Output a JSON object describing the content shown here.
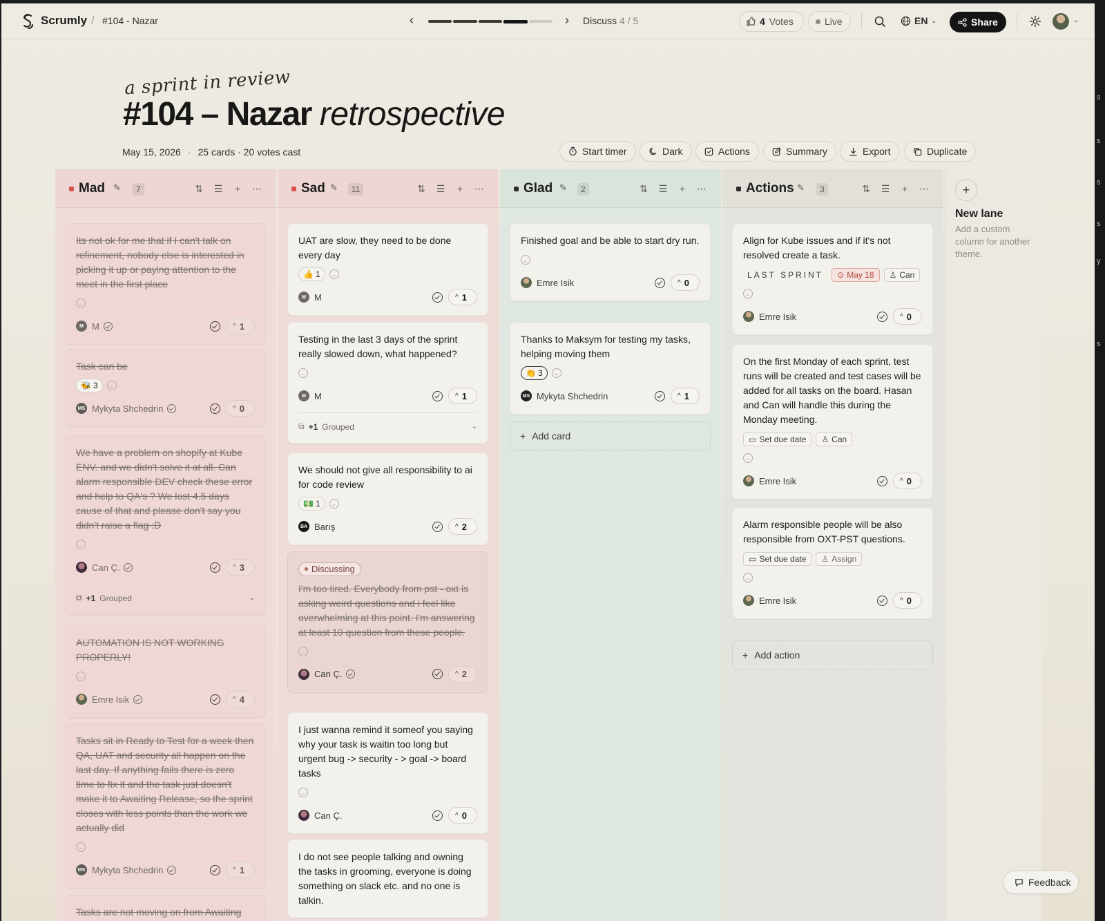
{
  "app": {
    "brand": "Scrumly",
    "breadcrumb": "#104 - Nazar"
  },
  "nav": {
    "phase_label": "Discuss",
    "phase_step": "4 / 5",
    "progress_current": 4,
    "progress_total": 5
  },
  "header": {
    "votes_count": "4",
    "votes_label": "Votes",
    "live_label": "Live",
    "lang": "EN",
    "share_label": "Share"
  },
  "hero": {
    "handwritten": "a sprint in review",
    "title_bold": "#104 – Nazar",
    "title_italic": "retrospective",
    "date": "May 15, 2026",
    "stats": "25 cards · 20 votes cast"
  },
  "toolbar": {
    "start_timer": "Start timer",
    "dark": "Dark",
    "actions": "Actions",
    "summary": "Summary",
    "export": "Export",
    "duplicate": "Duplicate"
  },
  "lanes": [
    {
      "name": "Mad",
      "count": "7",
      "color": "#d9534f",
      "cards": [
        {
          "text": "Its not ok for me that if I can't talk on refinement, nobody else is interested in picking it up or paying attention to the meet in the first place",
          "author": "M",
          "initials": "M",
          "votes": "1"
        },
        {
          "text": "Task can be",
          "reaction": "🐝",
          "reaction_count": "3",
          "author": "Mykyta Shchedrin",
          "initials": "MS",
          "votes": "0"
        },
        {
          "text": "We have a problem on shopify at Kube ENV. and we didn't solve it at all. Can alarm responsible DEV check these error and help to QA's ? We lost 4.5 days cause of that and please don't say you didn't raise a flag :D",
          "author": "Can Ç.",
          "votes": "3",
          "grouped": "+1",
          "grouped_label": "Grouped"
        },
        {
          "text": "AUTOMATION IS NOT WORKING PROPERLY!",
          "author": "Emre Isik",
          "votes": "4"
        },
        {
          "text": "Tasks sit in Ready to Test for a week then QA, UAT and security all happen on the last day. If anything fails there is zero time to fix it and the task just doesn't make it to Awaiting Release, so the sprint closes with less points than the work we actually did",
          "author": "Mykyta Shchedrin",
          "initials": "MS",
          "votes": "1"
        },
        {
          "text": "Tasks are not moving on from Awaiting"
        }
      ]
    },
    {
      "name": "Sad",
      "count": "11",
      "color": "#d9534f",
      "cards": [
        {
          "text": "UAT are slow, they need to be done every day",
          "reaction": "👍",
          "reaction_count": "1",
          "author": "M",
          "initials": "M",
          "votes": "1"
        },
        {
          "text": "Testing in the last 3 days of the sprint really slowed down, what happened?",
          "author": "M",
          "initials": "M",
          "votes": "1",
          "grouped": "+1",
          "grouped_label": "Grouped"
        },
        {
          "text": "We should not give all responsibility to ai for code review",
          "reaction": "💵",
          "reaction_count": "1",
          "author": "Barış",
          "initials": "BA",
          "votes": "2"
        },
        {
          "badge": "Discussing",
          "text": "I'm too tired. Everybody from pst - oxt is asking weird questions and i feel like overwhelming at this point. I'm answering at least 10 question from these people.",
          "author": "Can Ç.",
          "votes": "2"
        },
        {
          "text": "I just wanna remind it someof you saying why your task is waitin too long but urgent bug -> security - > goal -> board tasks",
          "author": "Can Ç.",
          "votes": "0"
        },
        {
          "text": "I do not see people talking and owning the tasks in grooming, everyone is doing something on slack etc. and no one is talkin."
        }
      ]
    },
    {
      "name": "Glad",
      "count": "2",
      "color": "#2b2b2b",
      "cards": [
        {
          "text": "Finished goal and be able to start dry run.",
          "author": "Emre Isik",
          "votes": "0"
        },
        {
          "text": "Thanks to Maksym for testing my tasks, helping moving them",
          "reaction": "👏",
          "reaction_count": "3",
          "author": "Mykyta Shchedrin",
          "initials": "MS",
          "votes": "1"
        }
      ],
      "add_label": "Add card"
    },
    {
      "name": "Actions",
      "count": "3",
      "color": "#2b2b2b",
      "cards": [
        {
          "text": "Align for Kube issues and if it's not resolved create a task.",
          "tag_sprint": "LAST SPRINT",
          "due": "May 18",
          "assignee": "Can",
          "author": "Emre Isik",
          "votes": "0"
        },
        {
          "text": "On the first Monday of each sprint, test runs will be created and test cases will be added for all tasks on the board. Hasan and Can will handle this during the Monday meeting.",
          "due": "Set due date",
          "assignee": "Can",
          "author": "Emre Isik",
          "votes": "0"
        },
        {
          "text": "Alarm responsible people will be also responsible from OXT-PST questions.",
          "due": "Set due date",
          "assignee": "Assign",
          "author": "Emre Isik",
          "votes": "0"
        }
      ],
      "add_label": "Add action"
    }
  ],
  "new_lane": {
    "title": "New lane",
    "desc": "Add a custom column for another theme."
  },
  "feedback_label": "Feedback",
  "edge_letters": [
    "s",
    "s",
    "s",
    "s",
    "y",
    "s"
  ]
}
